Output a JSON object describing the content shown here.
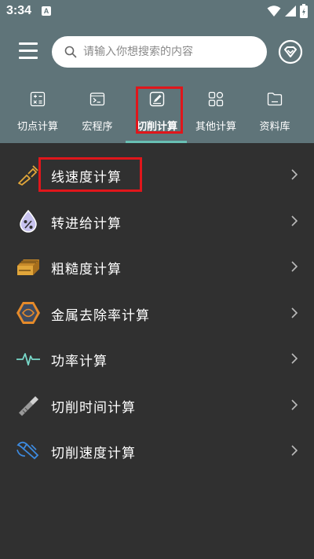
{
  "status_bar": {
    "time": "3:34",
    "notification_badge": "A"
  },
  "search": {
    "placeholder": "请输入你想搜索的内容"
  },
  "tabs": [
    {
      "label": "切点计算",
      "icon": "calculator-icon"
    },
    {
      "label": "宏程序",
      "icon": "terminal-icon"
    },
    {
      "label": "切削计算",
      "icon": "edit-square-icon",
      "active": true
    },
    {
      "label": "其他计算",
      "icon": "grid-icon"
    },
    {
      "label": "资料库",
      "icon": "folder-icon"
    }
  ],
  "items": [
    {
      "label": "线速度计算",
      "icon": "tool-spindle-icon"
    },
    {
      "label": "转进给计算",
      "icon": "percent-drop-icon"
    },
    {
      "label": "粗糙度计算",
      "icon": "surface-roughness-icon"
    },
    {
      "label": "金属去除率计算",
      "icon": "hexagon-nut-icon"
    },
    {
      "label": "功率计算",
      "icon": "pulse-wave-icon"
    },
    {
      "label": "切削时间计算",
      "icon": "cutting-tool-icon"
    },
    {
      "label": "切削速度计算",
      "icon": "speed-cutter-icon"
    }
  ],
  "colors": {
    "header_bg": "#5f7479",
    "body_bg": "#303030",
    "accent": "#68c0b4",
    "icon_gold": "#e1a63a",
    "icon_lavender": "#c7c2ee",
    "icon_blue": "#3d8be0",
    "icon_teal": "#78d8c9",
    "highlight": "#e0161b"
  }
}
